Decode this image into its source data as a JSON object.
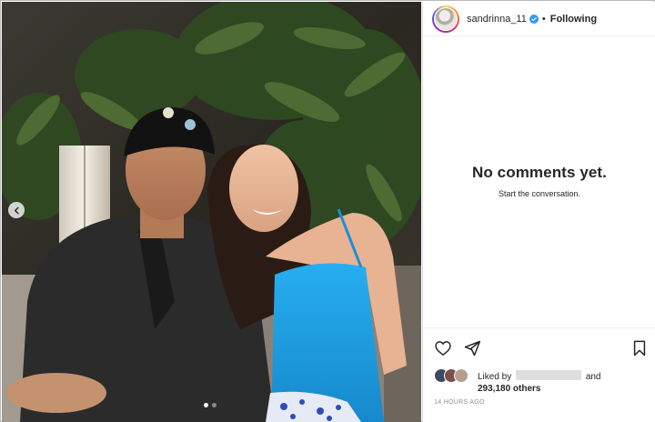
{
  "post": {
    "username": "sandrinna_11",
    "separator": "•",
    "follow_state": "Following",
    "verified_icon": "verified-badge-icon",
    "carousel": {
      "total": 2,
      "active_index": 1
    }
  },
  "comments": {
    "empty_title": "No comments yet.",
    "empty_subtitle": "Start the conversation."
  },
  "actions": {
    "like_icon": "heart-icon",
    "share_icon": "paper-plane-icon",
    "save_icon": "bookmark-icon"
  },
  "likes": {
    "prefix": "Liked by",
    "and": "and",
    "others": "293,180 others"
  },
  "timestamp": "14 HOURS AGO",
  "colors": {
    "verified": "#3897f0",
    "text": "#262626",
    "muted": "#8e8e8e",
    "dress": "#1e9ee0"
  }
}
